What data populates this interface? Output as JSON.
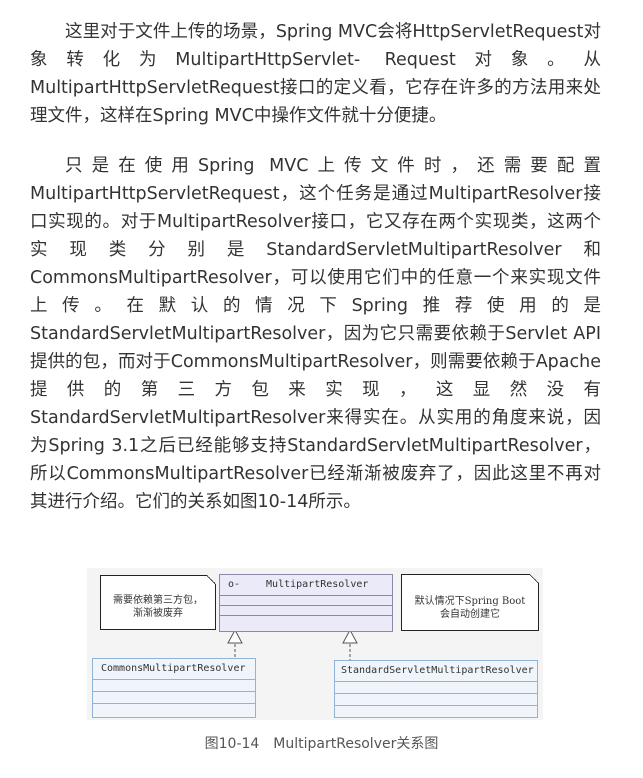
{
  "paragraphs": [
    "这里对于文件上传的场景，Spring MVC会将HttpServletRequest对象转化为MultipartHttpServlet- Request对象。从MultipartHttpServletRequest接口的定义看，它存在许多的方法用来处理文件，这样在Spring MVC中操作文件就十分便捷。",
    "只是在使用Spring MVC上传文件时，还需要配置MultipartHttpServletRequest，这个任务是通过MultipartResolver接口实现的。对于MultipartResolver接口，它又存在两个实现类，这两个实现类分别是StandardServletMultipartResolver和CommonsMultipartResolver，可以使用它们中的任意一个来实现文件上传。在默认的情况下Spring推荐使用的是StandardServletMultipartResolver，因为它只需要依赖于Servlet API提供的包，而对于CommonsMultipartResolver，则需要依赖于Apache提供的第三方包来实现，这显然没有StandardServletMultipartResolver来得实在。从实用的角度来说，因为Spring 3.1之后已经能够支持StandardServletMultipartResolver，所以CommonsMultipartResolver已经渐渐被废弃了，因此这里不再对其进行介绍。它们的关系如图10-14所示。"
  ],
  "diagram": {
    "interface": {
      "icon": "o-",
      "name": "MultipartResolver"
    },
    "impl_left": {
      "name": "CommonsMultipartResolver"
    },
    "impl_right": {
      "name": "StandardServletMultipartResolver"
    },
    "note_left": [
      "需要依赖第三方包，",
      "渐渐被废弃"
    ],
    "note_right": [
      "默认情况下Spring Boot",
      "会自动创建它"
    ]
  },
  "caption": "图10-14　MultipartResolver关系图"
}
